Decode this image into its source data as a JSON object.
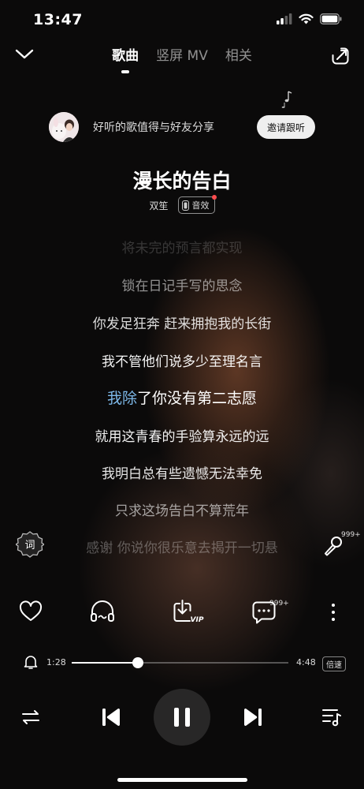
{
  "status_bar": {
    "time": "13:47"
  },
  "header": {
    "tabs": [
      {
        "label": "歌曲",
        "active": true
      },
      {
        "label": "竖屏 MV",
        "active": false
      },
      {
        "label": "相关",
        "active": false
      }
    ]
  },
  "share_row": {
    "text": "好听的歌值得与好友分享",
    "invite_label": "邀请跟听"
  },
  "song": {
    "title": "漫长的告白",
    "artist": "双笙",
    "effect_label": "音效"
  },
  "lyrics": [
    {
      "text": "将未完的预言都实现",
      "opacity": 0.18
    },
    {
      "text": "锁在日记手写的思念",
      "opacity": 0.55
    },
    {
      "text": "你发足狂奔 赶来拥抱我的长街",
      "opacity": 0.85
    },
    {
      "text": "我不管他们说多少至理名言",
      "opacity": 0.95
    },
    {
      "highlight": "我除",
      "rest": "了你没有第二志愿",
      "active": true
    },
    {
      "text": "就用这青春的手验算永远的远",
      "opacity": 0.95
    },
    {
      "text": "我明白总有些遗憾无法幸免",
      "opacity": 0.9
    },
    {
      "text": "只求这场告白不算荒年",
      "opacity": 0.6
    },
    {
      "text": "感谢 你说你很乐意去揭开一切悬",
      "opacity": 0.3
    }
  ],
  "side_buttons": {
    "lyrics_label": "词",
    "mic_count": "999+"
  },
  "actions": {
    "comment_count": "999+",
    "vip_label": "VIP"
  },
  "progress": {
    "current": "1:28",
    "total": "4:48",
    "fraction": 0.3056,
    "speed_label": "倍速"
  },
  "icons": {
    "collapse": "chevron-down-icon",
    "share": "share-icon",
    "like": "heart-icon",
    "listen": "headphones-icon",
    "download": "download-vip-icon",
    "comment": "comment-icon",
    "more": "more-vertical-icon",
    "alarm": "bell-icon",
    "mode": "repeat-icon",
    "prev": "previous-icon",
    "pause": "pause-icon",
    "next": "next-icon",
    "playlist": "playlist-icon"
  },
  "colors": {
    "lyric_highlight": "#7db8e8",
    "effect_dot": "#ff4d4f",
    "invite_bg": "#efefef"
  }
}
